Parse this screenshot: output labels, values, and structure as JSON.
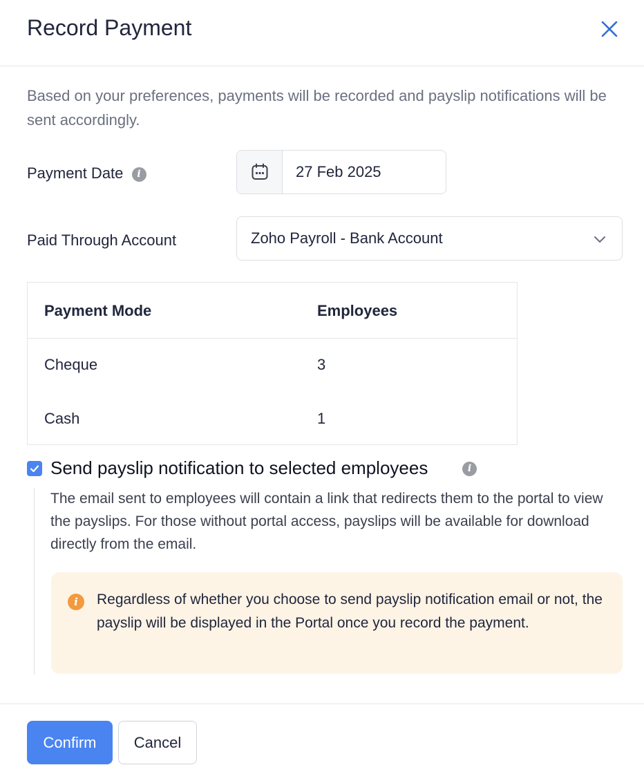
{
  "dialog": {
    "title": "Record Payment",
    "description": "Based on your preferences, payments will be recorded and payslip notifications will be sent accordingly."
  },
  "form": {
    "payment_date_label": "Payment Date",
    "payment_date_value": "27 Feb 2025",
    "paid_through_label": "Paid Through Account",
    "paid_through_value": "Zoho Payroll - Bank Account"
  },
  "table": {
    "headers": [
      "Payment Mode",
      "Employees"
    ],
    "rows": [
      [
        "Cheque",
        "3"
      ],
      [
        "Cash",
        "1"
      ]
    ]
  },
  "notification": {
    "checked": true,
    "label": "Send payslip notification to selected employees",
    "email_description": "The email sent to employees will contain a link that redirects them to the portal to view the payslips. For those without portal access, payslips will be available for download directly from the email.",
    "notice": "Regardless of whether you choose to send payslip notification email or not, the payslip will be displayed in the Portal once you record the payment."
  },
  "footer": {
    "confirm_label": "Confirm",
    "cancel_label": "Cancel"
  },
  "icons": {
    "close": "close-icon",
    "calendar": "calendar-icon",
    "chevron": "chevron-down-icon",
    "info": "info-icon",
    "check": "checkmark-icon"
  },
  "colors": {
    "accent": "#4a84f0",
    "close_icon": "#2f6fd6",
    "notice_bg": "#fdf4e6",
    "notice_icon": "#f39a3e"
  }
}
